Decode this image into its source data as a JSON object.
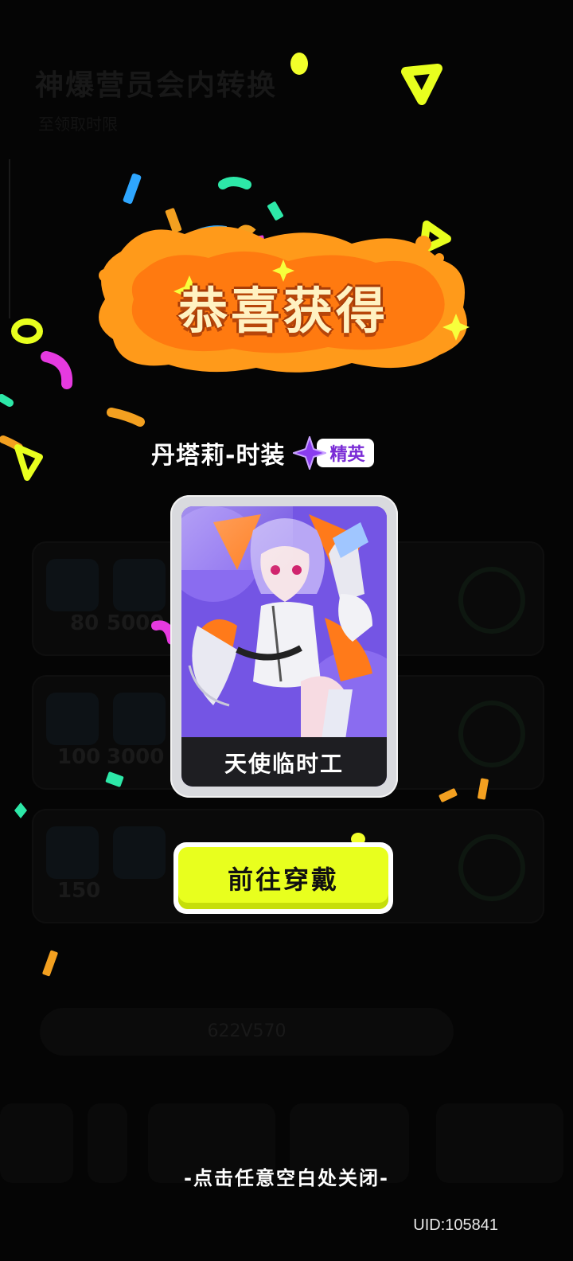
{
  "background": {
    "title": "神爆营员会内转换",
    "subtitle": "至领取时限",
    "rows": [
      {
        "nums": [
          "80",
          "5000"
        ]
      },
      {
        "nums": [
          "100",
          "3000"
        ]
      },
      {
        "nums": [
          "150",
          ""
        ]
      }
    ],
    "search_text": "622V570"
  },
  "reward": {
    "banner_title": "恭喜获得",
    "item_name": "丹塔莉-时装",
    "rarity_label": "精英",
    "card_caption": "天使临时工"
  },
  "actions": {
    "equip_button": "前往穿戴",
    "close_hint": "-点击任意空白处关闭-"
  },
  "footer": {
    "uid": "UID:105841"
  },
  "colors": {
    "accent_yellow": "#e8ff1e",
    "banner_orange": "#ff9a1a",
    "rarity_purple": "#7a2cd6",
    "card_purple": "#7657e6"
  }
}
